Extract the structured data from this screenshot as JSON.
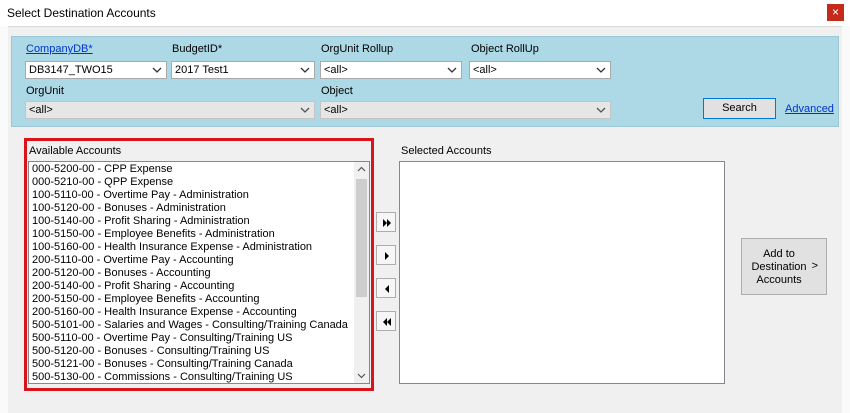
{
  "window": {
    "title": "Select Destination Accounts",
    "close_glyph": "×"
  },
  "filters": {
    "company_db": {
      "label": "CompanyDB*",
      "value": "DB3147_TWO15"
    },
    "budget_id": {
      "label": "BudgetID*",
      "value": "2017 Test1"
    },
    "orgunit_rollup": {
      "label": "OrgUnit Rollup",
      "value": "<all>"
    },
    "object_rollup": {
      "label": "Object RollUp",
      "value": "<all>"
    },
    "orgunit": {
      "label": "OrgUnit",
      "value": "<all>"
    },
    "object": {
      "label": "Object",
      "value": "<all>"
    },
    "search_label": "Search",
    "advanced_label": "Advanced"
  },
  "available": {
    "label": "Available Accounts",
    "items": [
      "000-5200-00 - CPP Expense",
      "000-5210-00 - QPP Expense",
      "100-5110-00 - Overtime Pay - Administration",
      "100-5120-00 - Bonuses - Administration",
      "100-5140-00 - Profit Sharing - Administration",
      "100-5150-00 - Employee Benefits - Administration",
      "100-5160-00 - Health Insurance Expense - Administration",
      "200-5110-00 - Overtime Pay - Accounting",
      "200-5120-00 - Bonuses - Accounting",
      "200-5140-00 - Profit Sharing - Accounting",
      "200-5150-00 - Employee Benefits - Accounting",
      "200-5160-00 - Health Insurance Expense - Accounting",
      "500-5101-00 - Salaries and Wages - Consulting/Training Canada",
      "500-5110-00 - Overtime Pay - Consulting/Training US",
      "500-5120-00 - Bonuses - Consulting/Training US",
      "500-5121-00 - Bonuses - Consulting/Training Canada",
      "500-5130-00 - Commissions - Consulting/Training US"
    ]
  },
  "selected": {
    "label": "Selected Accounts",
    "items": []
  },
  "add_button": {
    "line1": "Add to",
    "line2": "Destination",
    "line3": "Accounts",
    "chevron": ">"
  },
  "colors": {
    "filter_panel": "#add8e6",
    "highlight": "#d9151b",
    "link": "#0033cc",
    "close": "#c42b1c"
  }
}
